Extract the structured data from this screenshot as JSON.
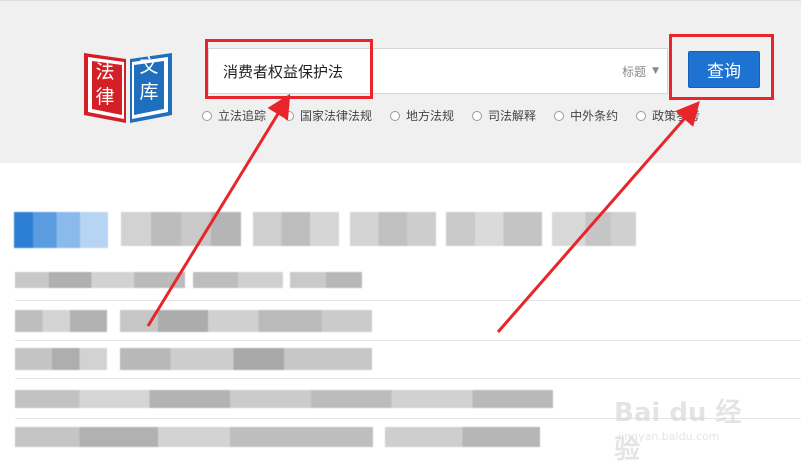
{
  "logo": {
    "chars": [
      "法",
      "文",
      "律",
      "库"
    ],
    "colors": {
      "left": "#d32027",
      "right": "#1f6fbf"
    }
  },
  "search": {
    "value": "消费者权益保护法",
    "field": "标题",
    "button": "查询"
  },
  "scopes": [
    "立法追踪",
    "国家法律法规",
    "地方法规",
    "司法解释",
    "中外条约",
    "政策参考"
  ],
  "watermark": {
    "brand": "Bai du 经验",
    "url": "jingyan.baidu.com"
  },
  "colors": {
    "annotation": "#e8252a",
    "button": "#1e73d2",
    "header_bg": "#f0f0f0"
  }
}
